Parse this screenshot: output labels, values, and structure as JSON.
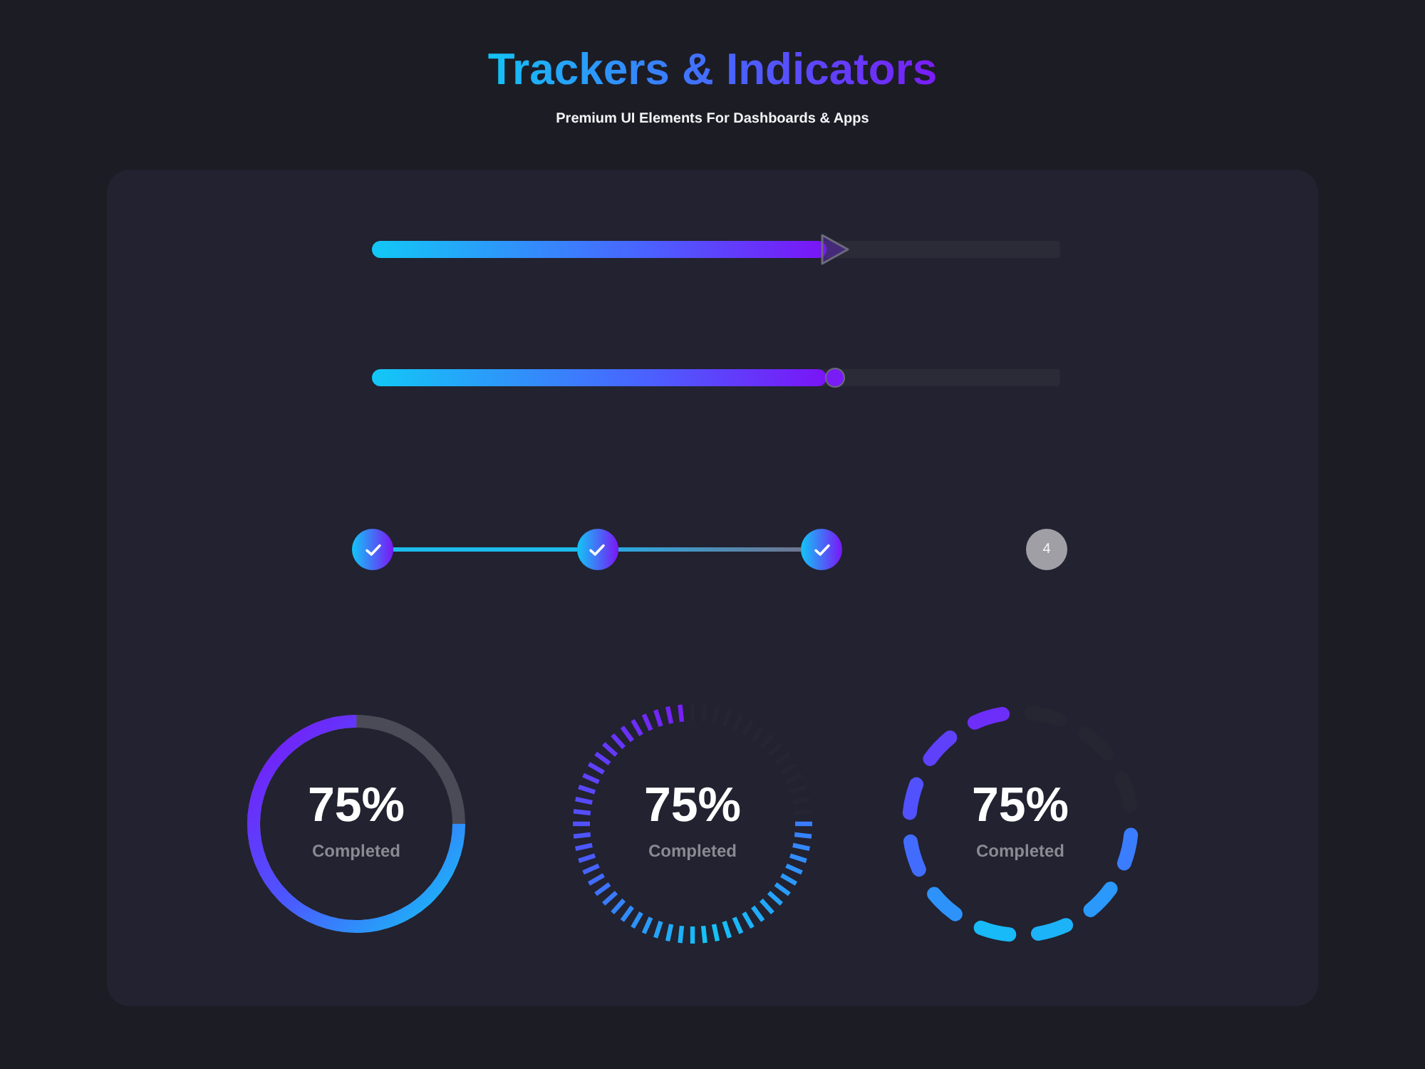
{
  "header": {
    "title": "Trackers & Indicators",
    "subtitle": "Premium UI Elements For Dashboards & Apps"
  },
  "sliders": [
    {
      "kind": "arrow",
      "level": 0.66
    },
    {
      "kind": "dot",
      "level": 0.66
    }
  ],
  "steps": [
    {
      "done": true
    },
    {
      "done": true
    },
    {
      "done": true
    },
    {
      "label": "4",
      "done": false
    }
  ],
  "rings": [
    {
      "kind": "solid",
      "value": "75%",
      "caption": "Completed"
    },
    {
      "kind": "ticks",
      "value": "75%",
      "caption": "Completed"
    },
    {
      "kind": "dashes",
      "value": "75%",
      "caption": "Completed"
    }
  ]
}
